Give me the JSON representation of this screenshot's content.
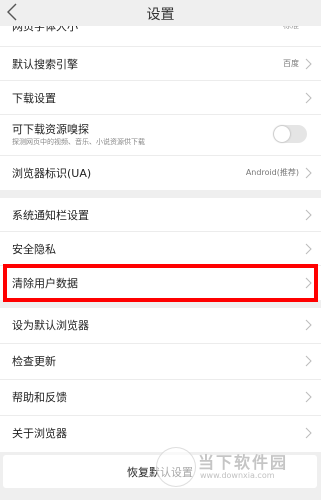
{
  "header": {
    "title": "设置"
  },
  "group1": {
    "partial_label": "网页字体大小",
    "partial_value": "标准",
    "search_engine": {
      "label": "默认搜索引擎",
      "value": "百度"
    },
    "download": {
      "label": "下载设置"
    },
    "sniff": {
      "label": "可下载资源嗅探",
      "sub": "探测网页中的视频、音乐、小说资源供下载",
      "enabled": false
    },
    "ua": {
      "label": "浏览器标识(UA)",
      "value": "Android(推荐)"
    }
  },
  "group2": {
    "notify": {
      "label": "系统通知栏设置"
    },
    "privacy": {
      "label": "安全隐私"
    },
    "clear": {
      "label": "清除用户数据"
    }
  },
  "group3": {
    "default_browser": {
      "label": "设为默认浏览器"
    },
    "update": {
      "label": "检查更新"
    },
    "help": {
      "label": "帮助和反馈"
    },
    "about": {
      "label": "关于浏览器"
    }
  },
  "footer": {
    "restore_label": "恢复默认设置"
  },
  "watermark": {
    "text": "当下软件园",
    "url": "www.downxia.com"
  },
  "colors": {
    "highlight": "#ff0000",
    "background": "#efefef"
  }
}
